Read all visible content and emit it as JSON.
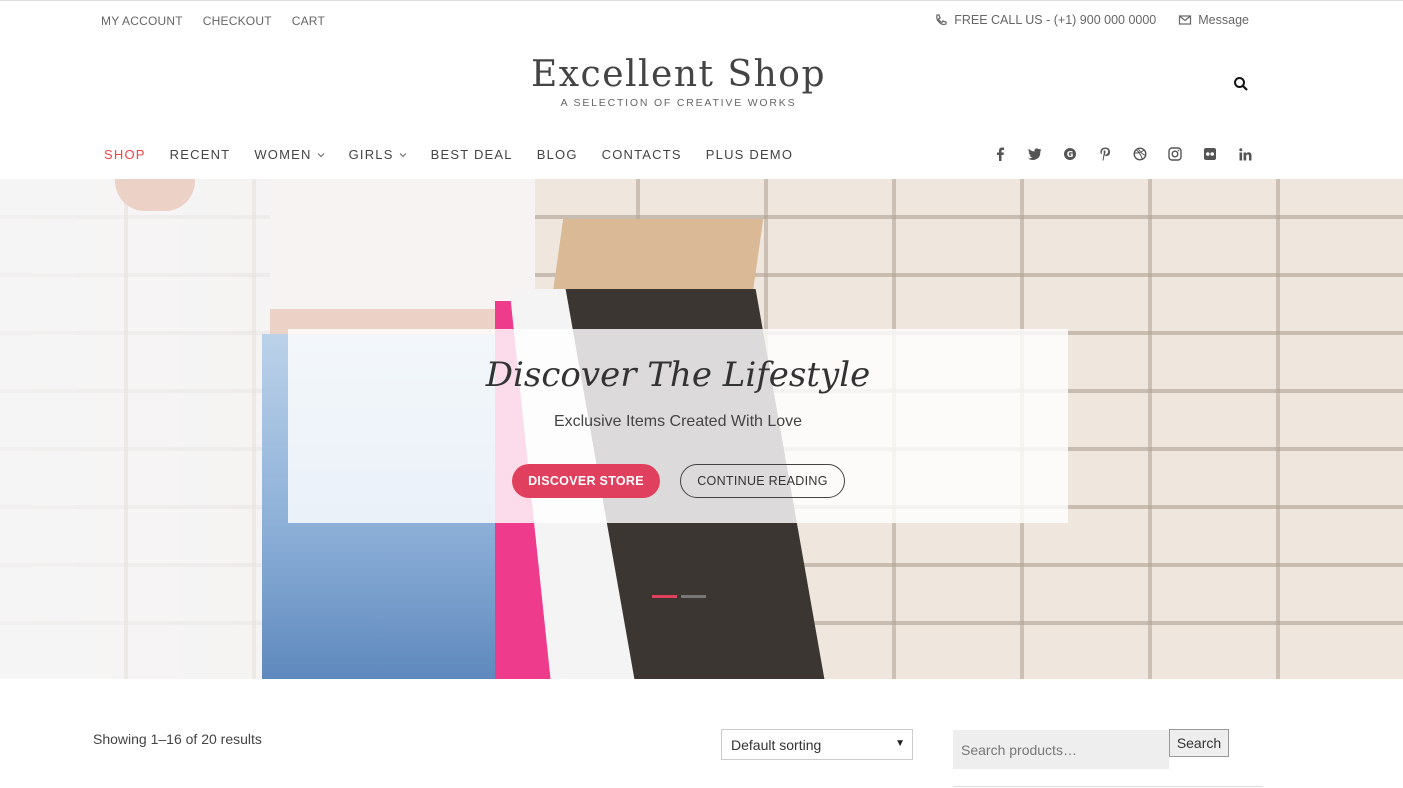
{
  "top_links": [
    "MY ACCOUNT",
    "CHECKOUT",
    "CART"
  ],
  "contact": {
    "phone_label": "FREE CALL US - (+1) 900 000 0000",
    "message_label": "Message"
  },
  "brand": {
    "title": "Excellent Shop",
    "tagline": "A SELECTION OF CREATIVE WORKS"
  },
  "nav": [
    {
      "label": "SHOP",
      "active": true,
      "dropdown": false
    },
    {
      "label": "RECENT",
      "active": false,
      "dropdown": false
    },
    {
      "label": "WOMEN",
      "active": false,
      "dropdown": true
    },
    {
      "label": "GIRLS",
      "active": false,
      "dropdown": true
    },
    {
      "label": "BEST DEAL",
      "active": false,
      "dropdown": false
    },
    {
      "label": "BLOG",
      "active": false,
      "dropdown": false
    },
    {
      "label": "CONTACTS",
      "active": false,
      "dropdown": false
    },
    {
      "label": "PLUS DEMO",
      "active": false,
      "dropdown": false
    }
  ],
  "social_icons": [
    "facebook-icon",
    "twitter-icon",
    "google-plus-icon",
    "pinterest-icon",
    "dribbble-icon",
    "instagram-icon",
    "flickr-icon",
    "linkedin-icon"
  ],
  "hero": {
    "title": "Discover The Lifestyle",
    "subtitle": "Exclusive Items Created With Love",
    "primary_button": "DISCOVER STORE",
    "secondary_button": "CONTINUE READING",
    "slide_count": 2,
    "active_slide": 1
  },
  "shop": {
    "results_text": "Showing 1–16 of 20 results",
    "sort_selected": "Default sorting",
    "search_placeholder": "Search products…",
    "search_button": "Search"
  },
  "colors": {
    "accent": "#e0405d",
    "nav_active": "#e44444"
  }
}
